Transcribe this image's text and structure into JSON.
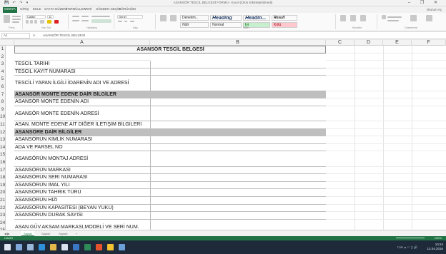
{
  "window": {
    "title": "ASANSÖR TESCİL BELGESİ FORMU - Excel (Ürün Etkinleştirilmedi)",
    "quick_access": "💾 ↶ ↷ ▾",
    "controls": "–  ❐  ✕",
    "user": "Oturum Aç"
  },
  "ribbon_tabs": [
    "DOSYA",
    "GİRİŞ",
    "EKLE",
    "SAYFA DÜZENİ",
    "FORMÜLLER",
    "VERİ",
    "GÖZDEN GEÇİR",
    "GÖRÜNÜM"
  ],
  "ribbon": {
    "groups": [
      "Pano",
      "Yazı Tipi",
      "Hizalama",
      "Sayı",
      "Stiller",
      "Hücreler",
      "Düzenleme"
    ],
    "styles": {
      "heading1": "Heading",
      "heading2": "Headin...",
      "result": "Result",
      "normal": "Normal",
      "bad": "Kötü",
      "good": "İyi",
      "neutral": "Nötr",
      "check": "Denetim..."
    },
    "font_name": "Calibri",
    "font_size": "11",
    "number_format": "Genel"
  },
  "formula_bar": {
    "name_box": "A1",
    "fx": "fx",
    "content": "ASANSÖR TESCİL BELGESİ"
  },
  "columns": [
    "A",
    "B",
    "C",
    "D",
    "E",
    "F"
  ],
  "rows": [
    {
      "n": "1",
      "a": "ASANSÖR  TESCİL  BELGESİ",
      "type": "title"
    },
    {
      "n": "2",
      "a": "",
      "type": "blank"
    },
    {
      "n": "3",
      "a": "TESCİL TARİHİ",
      "type": "field"
    },
    {
      "n": "4",
      "a": "TESCİL KAYIT NUMARASI",
      "type": "field"
    },
    {
      "n": "5",
      "a": "TESCİLİ YAPAN İLGİLİ İDARENİN ADI VE ADRESİ",
      "type": "field-tall"
    },
    {
      "n": "7",
      "a": "ASANSÖR MONTE EDENE DAİR BİLGİLER",
      "type": "section"
    },
    {
      "n": "8",
      "a": "ASANSÖR MONTE EDENİN ADI",
      "type": "field"
    },
    {
      "n": "9",
      "a": "ASANSÖR MONTE EDENİN ADRESİ",
      "type": "field-tall"
    },
    {
      "n": "11",
      "a": "ASAN. MONTE EDENE AİT  DİĞER İLETİŞİM BİLGİLERİ",
      "type": "field"
    },
    {
      "n": "12",
      "a": "ASANSÖRE DAİR BİLGİLER",
      "type": "section"
    },
    {
      "n": "13",
      "a": "ASANSÖRÜN KİMLİK NUMARASI",
      "type": "field"
    },
    {
      "n": "14",
      "a": "ADA VE PARSEL NO",
      "type": "field"
    },
    {
      "n": "15",
      "a": "ASANSÖRÜN MONTAJ ADRESİ",
      "type": "field-tall"
    },
    {
      "n": "17",
      "a": "ASANSÖRÜN MARKASI",
      "type": "field"
    },
    {
      "n": "18",
      "a": "ASANSÖRÜN SERİ NUMARASI",
      "type": "field"
    },
    {
      "n": "19",
      "a": "ASANSÖRÜN İMAL YILI",
      "type": "field"
    },
    {
      "n": "20",
      "a": "ASANSÖRÜN TAHRİK TÜRÜ",
      "type": "field"
    },
    {
      "n": "21",
      "a": "ASANSÖRÜN HIZI",
      "type": "field"
    },
    {
      "n": "22",
      "a": "ASANSÖRÜN KAPASİTESİ (BEYAN YÜKÜ)",
      "type": "field"
    },
    {
      "n": "23",
      "a": "ASANSÖRÜN DURAK SAYISI",
      "type": "field"
    },
    {
      "n": "24",
      "a": "ASAN.GÜV.AKSAM.MARKASI,MODELİ VE SERİ NUM.",
      "type": "field-tall"
    }
  ],
  "extra_row_labels": [
    "6",
    "10",
    "16",
    "25"
  ],
  "b1_value": "B",
  "sheets": [
    "Sayfa1",
    "Sayfa2",
    "Sayfa3",
    "+"
  ],
  "status": {
    "ready": "HAZIR",
    "zoom": "100%"
  },
  "taskbar": {
    "tray": "TUR  ▲  ⚐  ◻  🔊",
    "time": "10:24",
    "date": "12.04.2016"
  },
  "colors": {
    "excel_green": "#217346",
    "section_gray": "#bfbfbf",
    "taskbar": "#1e2a3a"
  }
}
